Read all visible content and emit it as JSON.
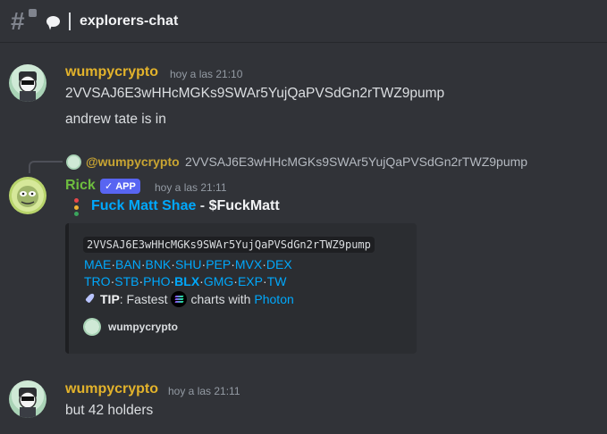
{
  "channel": {
    "name": "explorers-chat"
  },
  "messages": [
    {
      "author": "wumpycrypto",
      "time": "hoy a las 21:10",
      "lines": [
        "2VVSAJ6E3wHHcMGKs9SWAr5YujQaPVSdGn2rTWZ9pump",
        "andrew tate is in"
      ]
    },
    {
      "reply": {
        "author": "@wumpycrypto",
        "text": "2VVSAJ6E3wHHcMGKs9SWAr5YujQaPVSdGn2rTWZ9pump"
      },
      "author": "Rick",
      "badge": "APP",
      "time": "hoy a las 21:11",
      "headline": {
        "link": "Fuck Matt Shae",
        "dash": " - ",
        "ticker": "$FuckMatt"
      },
      "embed": {
        "address": "2VVSAJ6E3wHHcMGKs9SWAr5YujQaPVSdGn2rTWZ9pump",
        "row1": [
          "MAE",
          "BAN",
          "BNK",
          "SHU",
          "PEP",
          "MVX",
          "DEX"
        ],
        "row2": [
          "TRO",
          "STB",
          "PHO",
          "BLX",
          "GMG",
          "EXP",
          "TW"
        ],
        "tip_label": "TIP",
        "tip_text1": ": Fastest",
        "tip_text2": "charts with",
        "tip_link": "Photon",
        "footer": "wumpycrypto"
      }
    },
    {
      "author": "wumpycrypto",
      "time": "hoy a las 21:11",
      "lines": [
        "but 42 holders"
      ]
    }
  ],
  "colors": {
    "background": "#313338",
    "link": "#00a8fc",
    "wumpy_name": "#e3b32b",
    "rick_name": "#6ebd3f",
    "app_badge": "#5865f2"
  },
  "icons": {
    "header": [
      "channel-hash-icon",
      "speech-bubble-icon"
    ],
    "tip": [
      "rocket-icon",
      "solana-icon"
    ]
  }
}
